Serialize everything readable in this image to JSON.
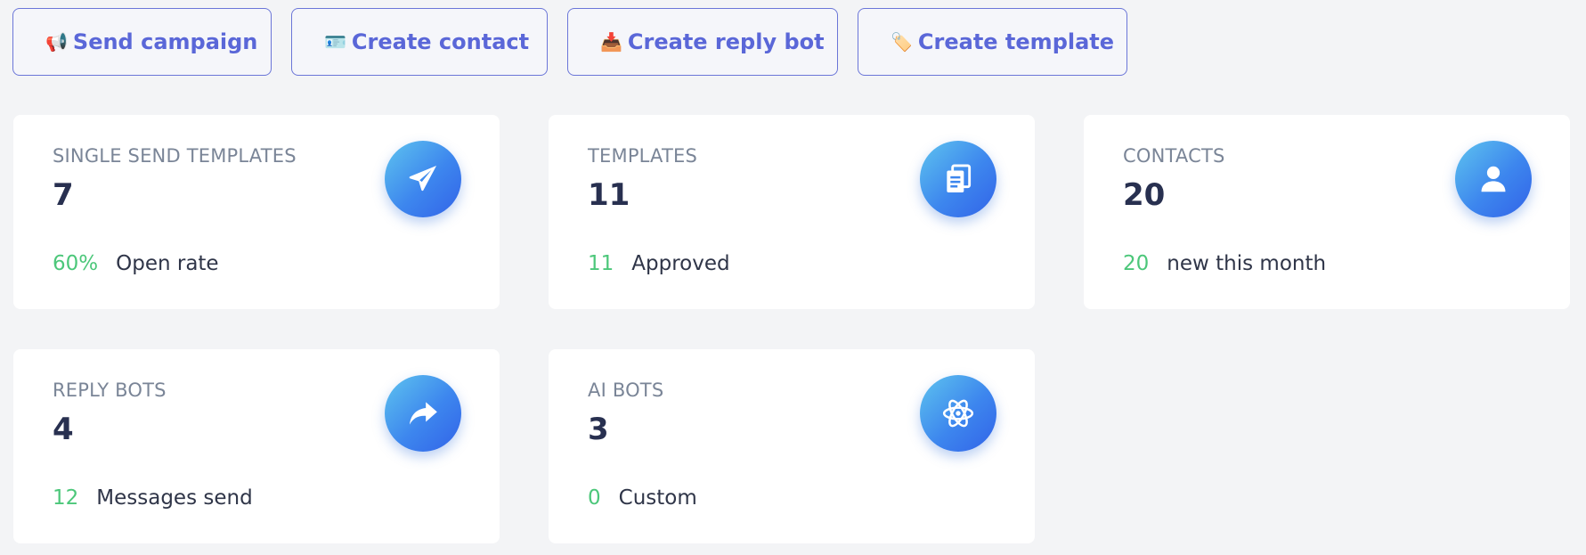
{
  "actions": [
    {
      "emoji": "📢",
      "label": "Send campaign"
    },
    {
      "emoji": "🪪",
      "label": "Create contact"
    },
    {
      "emoji": "📥",
      "label": "Create reply bot"
    },
    {
      "emoji": "🏷️",
      "label": "Create template"
    }
  ],
  "cards": [
    {
      "title": "SINGLE SEND TEMPLATES",
      "value": "7",
      "stat": "60%",
      "stat_label": "Open rate",
      "icon": "paper-plane-icon"
    },
    {
      "title": "TEMPLATES",
      "value": "11",
      "stat": "11",
      "stat_label": "Approved",
      "icon": "documents-icon"
    },
    {
      "title": "CONTACTS",
      "value": "20",
      "stat": "20",
      "stat_label": "new this month",
      "icon": "user-icon"
    },
    {
      "title": "REPLY BOTS",
      "value": "4",
      "stat": "12",
      "stat_label": "Messages send",
      "icon": "share-arrow-icon"
    },
    {
      "title": "AI BOTS",
      "value": "3",
      "stat": "0",
      "stat_label": "Custom",
      "icon": "atom-icon"
    }
  ],
  "colors": {
    "accent": "#5a67d8",
    "stat_green": "#4cc77a",
    "icon_gradient_start": "#5ec4ef",
    "icon_gradient_end": "#3263e8"
  }
}
